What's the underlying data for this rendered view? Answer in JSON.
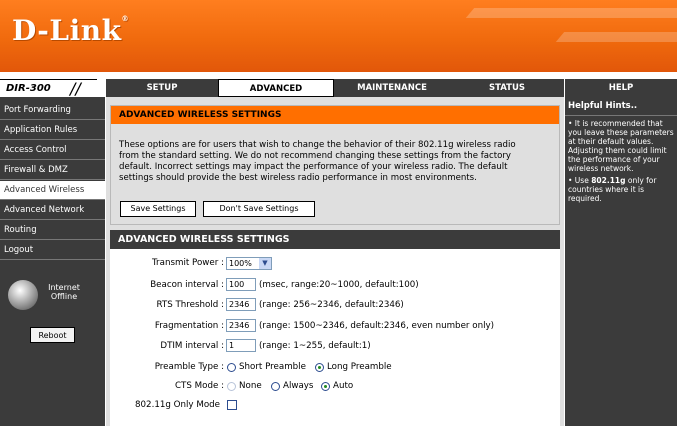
{
  "brand": {
    "logo": "D-Link",
    "reg": "®",
    "model": "DIR-300",
    "model_slashes": "//"
  },
  "tabs": [
    {
      "label": "SETUP"
    },
    {
      "label": "ADVANCED"
    },
    {
      "label": "MAINTENANCE"
    },
    {
      "label": "STATUS"
    },
    {
      "label": "HELP"
    }
  ],
  "sidebar": {
    "items": [
      {
        "label": "Port Forwarding"
      },
      {
        "label": "Application Rules"
      },
      {
        "label": "Access Control"
      },
      {
        "label": "Firewall & DMZ"
      },
      {
        "label": "Advanced Wireless"
      },
      {
        "label": "Advanced Network"
      },
      {
        "label": "Routing"
      },
      {
        "label": "Logout"
      }
    ],
    "status_line1": "Internet",
    "status_line2": "Offline",
    "reboot": "Reboot"
  },
  "main": {
    "section1_title": "ADVANCED WIRELESS SETTINGS",
    "intro_lines": [
      "These options are for users that wish to change the behavior of their 802.11g wireless radio",
      "from the standard setting. We do not recommend changing these settings from the factory",
      "default. Incorrect settings may impact the performance of your wireless radio. The default",
      "settings should provide the best wireless radio performance in most environments."
    ],
    "save_label": "Save Settings",
    "dont_save_label": "Don't Save Settings",
    "section2_title": "ADVANCED WIRELESS SETTINGS",
    "transmit_power": {
      "label": "Transmit Power :",
      "value": "100%"
    },
    "beacon": {
      "label": "Beacon interval :",
      "value": "100",
      "hint": "(msec, range:20~1000, default:100)"
    },
    "rts": {
      "label": "RTS Threshold :",
      "value": "2346",
      "hint": "(range: 256~2346, default:2346)"
    },
    "frag": {
      "label": "Fragmentation :",
      "value": "2346",
      "hint": "(range: 1500~2346, default:2346, even number only)"
    },
    "dtim": {
      "label": "DTIM interval :",
      "value": "1",
      "hint": "(range: 1~255, default:1)"
    },
    "preamble": {
      "label": "Preamble Type :",
      "short": "Short Preamble",
      "long": "Long Preamble",
      "selected": "Long Preamble"
    },
    "cts": {
      "label": "CTS Mode :",
      "none": "None",
      "always": "Always",
      "auto": "Auto",
      "selected": "Auto"
    },
    "g_only": {
      "label": "802.11g Only Mode",
      "checked": false
    }
  },
  "help": {
    "title": "Helpful Hints..",
    "hint1": "• It is recommended that you leave these parameters at their default values. Adjusting them could limit the performance of your wireless network.",
    "hint2_prefix": "• Use ",
    "hint2_bold": "802.11g",
    "hint2_suffix": " only for countries where it is required."
  },
  "colors": {
    "orange": "#ff6f00",
    "dark": "#3b3b3b",
    "panel": "#dfdfdf"
  }
}
